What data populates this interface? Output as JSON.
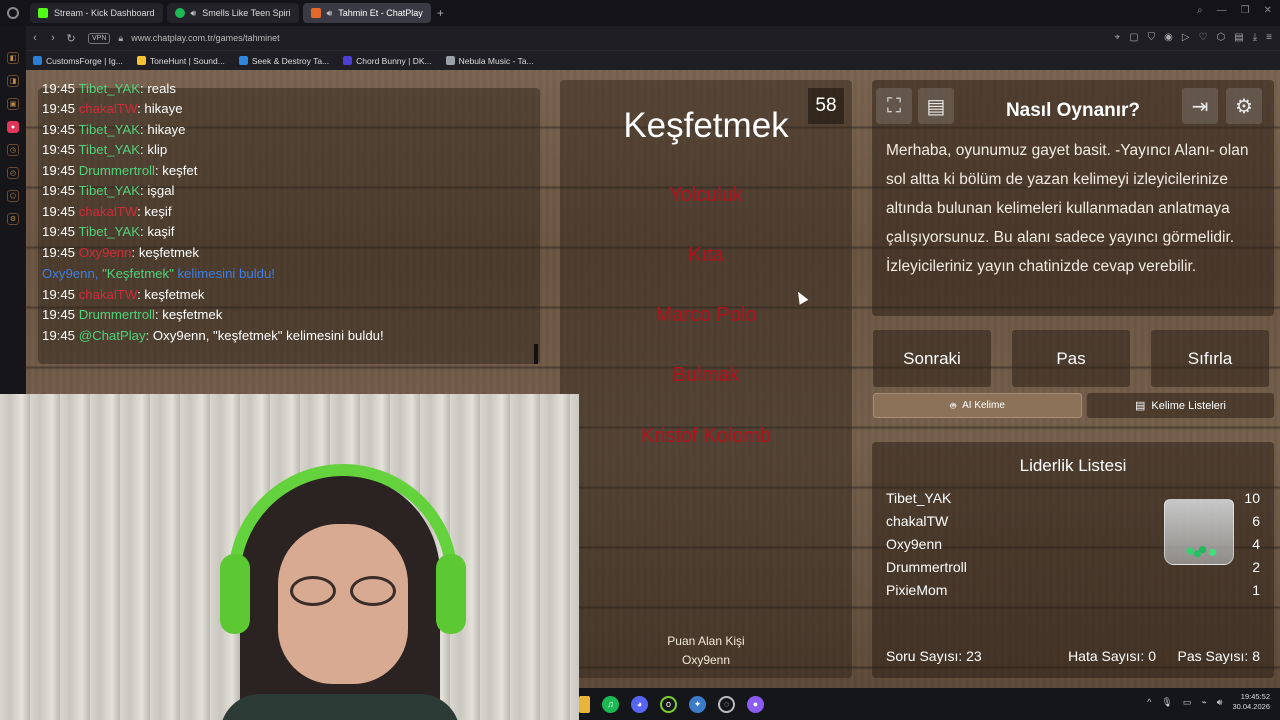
{
  "browser": {
    "tabs": [
      {
        "label": "Stream - Kick Dashboard",
        "icon_color": "#53fc18",
        "active": false
      },
      {
        "label": "Smells Like Teen Spiri",
        "icon_color": "#1db954",
        "active": false
      },
      {
        "label": "Tahmin Et - ChatPlay",
        "icon_color": "#e36a2b",
        "active": true
      }
    ],
    "tab_add": "+",
    "vpn_badge": "VPN",
    "url": "www.chatplay.com.tr/games/tahminet",
    "bookmarks": [
      {
        "label": "CustomsForge | Ig...",
        "icon_color": "#2a7fd4"
      },
      {
        "label": "ToneHunt | Sound...",
        "icon_color": "#f1c232"
      },
      {
        "label": "Seek & Destroy Ta...",
        "icon_color": "#2e86de"
      },
      {
        "label": "Chord Bunny | DK...",
        "icon_color": "#4b3fd4"
      },
      {
        "label": "Nebula Music - Ta...",
        "icon_color": "#9aa0a6"
      }
    ]
  },
  "chat": {
    "lines": [
      {
        "time": "19:45",
        "user": "Tibet_YAK",
        "user_color": "green",
        "text": "reals"
      },
      {
        "time": "19:45",
        "user": "chakalTW",
        "user_color": "red",
        "text": "hikaye"
      },
      {
        "time": "19:45",
        "user": "Tibet_YAK",
        "user_color": "green",
        "text": "hikaye"
      },
      {
        "time": "19:45",
        "user": "Tibet_YAK",
        "user_color": "green",
        "text": "klip"
      },
      {
        "time": "19:45",
        "user": "Drummertroll",
        "user_color": "green",
        "text": "keşfet"
      },
      {
        "time": "19:45",
        "user": "Tibet_YAK",
        "user_color": "green",
        "text": "işgal"
      },
      {
        "time": "19:45",
        "user": "chakalTW",
        "user_color": "red",
        "text": "keşif"
      },
      {
        "time": "19:45",
        "user": "Tibet_YAK",
        "user_color": "green",
        "text": "kaşif"
      },
      {
        "time": "19:45",
        "user": "Oxy9enn",
        "user_color": "red",
        "text": "keşfetmek"
      }
    ],
    "system": {
      "user": "Oxy9enn",
      "sep": ", ",
      "word": "\"Keşfetmek\"",
      "tail": " kelimesini buldu!"
    },
    "lines_after": [
      {
        "time": "19:45",
        "user": "chakalTW",
        "user_color": "red",
        "text": "keşfetmek"
      },
      {
        "time": "19:45",
        "user": "Drummertroll",
        "user_color": "green",
        "text": "keşfetmek"
      },
      {
        "time": "19:45",
        "user": "@ChatPlay",
        "user_color": "blue",
        "text": "Oxy9enn, \"keşfetmek\" kelimesini buldu!"
      }
    ]
  },
  "game": {
    "timer": "58",
    "word": "Keşfetmek",
    "forbidden_words": [
      "Yolculuk",
      "Kıta",
      "Marco Polo",
      "Bulmak",
      "Kristof Kolomb"
    ],
    "scorer_label": "Puan Alan Kişi",
    "scorer_name": "Oxy9enn"
  },
  "help": {
    "title": "Nasıl Oynanır?",
    "text": "Merhaba, oyunumuz gayet basit. -Yayıncı Alanı- olan sol altta ki bölüm de yazan kelimeyi izleyicilerinize altında bulunan kelimeleri kullanmadan anlatmaya çalışıyorsunuz. Bu alanı sadece yayıncı görmelidir. İzleyicileriniz yayın chatinizde cevap verebilir."
  },
  "actions": {
    "next": "Sonraki",
    "pass": "Pas",
    "reset": "Sıfırla",
    "ai_word": "AI Kelime",
    "word_lists": "Kelime Listeleri"
  },
  "leaderboard": {
    "title": "Liderlik Listesi",
    "rows": [
      {
        "name": "Tibet_YAK",
        "score": "10"
      },
      {
        "name": "chakalTW",
        "score": "6"
      },
      {
        "name": "Oxy9enn",
        "score": "4"
      },
      {
        "name": "Drummertroll",
        "score": "2"
      },
      {
        "name": "PixieMom",
        "score": "1"
      }
    ],
    "stats": {
      "questions": "Soru Sayısı: 23",
      "errors": "Hata Sayısı: 0",
      "passes": "Pas Sayısı: 8"
    }
  },
  "taskbar": {
    "clock_time": "19:45:52",
    "clock_date": "30.04.2026",
    "tray_chevron": "^"
  },
  "colors": {
    "chat_green": "#4fd27a",
    "chat_red": "#d32a3a",
    "forbidden_red": "#b5101c",
    "system_blue": "#3e7ee6"
  }
}
